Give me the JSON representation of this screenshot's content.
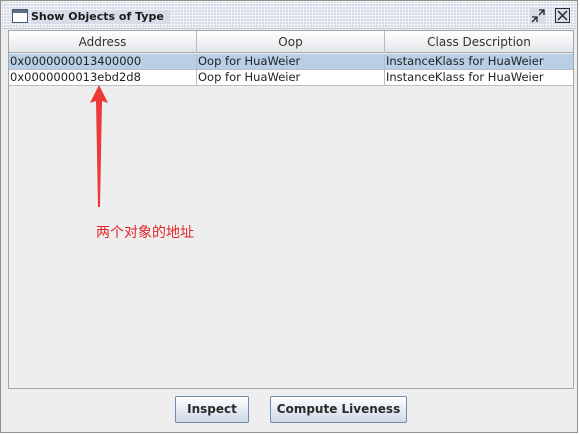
{
  "window": {
    "title": "Show Objects of Type"
  },
  "table": {
    "columns": [
      "Address",
      "Oop",
      "Class Description"
    ],
    "rows": [
      {
        "address": "0x0000000013400000",
        "oop": "Oop for HuaWeier",
        "class_description": "InstanceKlass for HuaWeier",
        "selected": true
      },
      {
        "address": "0x0000000013ebd2d8",
        "oop": "Oop for HuaWeier",
        "class_description": "InstanceKlass for HuaWeier",
        "selected": false
      }
    ]
  },
  "annotation": {
    "text": "两个对象的地址",
    "color": "#e2262b"
  },
  "buttons": {
    "inspect": "Inspect",
    "compute_liveness": "Compute Liveness"
  },
  "colors": {
    "selection": "#b8cfe5",
    "button_border": "#6e8bb0"
  }
}
